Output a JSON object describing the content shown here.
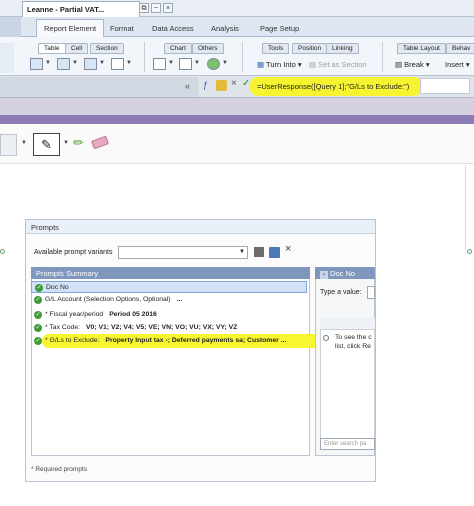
{
  "document_tab": {
    "title": "Leanne - Partial VAT..."
  },
  "ribbon_tabs": [
    "Report Element",
    "Format",
    "Data Access",
    "Analysis",
    "Page Setup"
  ],
  "groups": {
    "table": "Table",
    "cell": "Cell",
    "section": "Section",
    "chart": "Chart",
    "others": "Others",
    "tools": "Tools",
    "position": "Position",
    "linking": "Linking",
    "table_layout": "Table Layout",
    "behavior": "Behav"
  },
  "toolbar": {
    "turn_into": "Turn Into",
    "set_as_section": "Set as Section",
    "break": "Break",
    "insert": "Insert"
  },
  "formula": {
    "value": "=UserResponse([Query 1];\"G/Ls to Exclude:\")"
  },
  "dialog": {
    "title": "Prompts",
    "variants_label": "Available prompt variants",
    "summary_header": "Prompts Summary",
    "prompts": [
      {
        "label": "Doc No",
        "value": ""
      },
      {
        "label": "G/L Account (Selection Options, Optional)",
        "value": "..."
      },
      {
        "label": "* Fiscal year/period",
        "value": "Period 05 2016"
      },
      {
        "label": "* Tax Code:",
        "value": "V0; V1; V2; V4; V5; VE; VN; VO; VU; VX; VY; VZ"
      },
      {
        "label": "* G/Ls to Exclude:",
        "value": "Property Input tax -; Deferred payments sa; Customer ..."
      }
    ],
    "right_header": "Doc No",
    "type_value_label": "Type a value:",
    "info_text_1": "To see the c",
    "info_text_2": "list, click Re",
    "search_placeholder": "Enter search pa",
    "required_note": "* Required prompts"
  },
  "colors": {
    "highlight": "#f7f520",
    "check": "#3e9b37",
    "panel_header": "#7f97bc",
    "purple": "#8d7bb4"
  }
}
